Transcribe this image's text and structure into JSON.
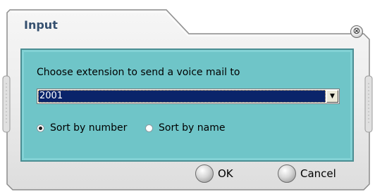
{
  "window": {
    "title": "Input",
    "close_glyph": "⊗"
  },
  "panel": {
    "prompt": "Choose extension to send a voice mail to"
  },
  "extension_select": {
    "selected": "2001",
    "arrow_glyph": "▼"
  },
  "sort_options": [
    {
      "label": "Sort by number",
      "selected": true
    },
    {
      "label": "Sort by name",
      "selected": false
    }
  ],
  "buttons": {
    "ok": "OK",
    "cancel": "Cancel"
  },
  "colors": {
    "panel_bg": "#6fc5c8",
    "selection_bg": "#0a246a",
    "title_text": "#35506f"
  }
}
